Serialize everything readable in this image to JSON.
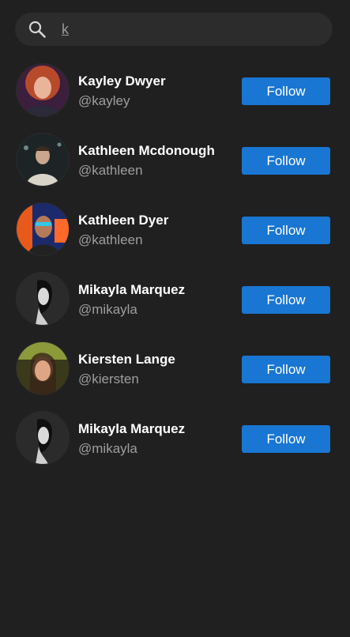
{
  "search": {
    "value": "k",
    "icon": "search-icon"
  },
  "users": [
    {
      "name": "Kayley Dwyer",
      "handle": "@kayley",
      "follow_label": "Follow"
    },
    {
      "name": "Kathleen Mcdonough",
      "handle": "@kathleen",
      "follow_label": "Follow"
    },
    {
      "name": "Kathleen Dyer",
      "handle": "@kathleen",
      "follow_label": "Follow"
    },
    {
      "name": "Mikayla Marquez",
      "handle": "@mikayla",
      "follow_label": "Follow"
    },
    {
      "name": "Kiersten Lange",
      "handle": "@kiersten",
      "follow_label": "Follow"
    },
    {
      "name": "Mikayla Marquez",
      "handle": "@mikayla",
      "follow_label": "Follow"
    }
  ],
  "colors": {
    "background": "#202020",
    "search_bar": "#2c2c2c",
    "accent": "#1976d2",
    "secondary_text": "#9e9e9e"
  }
}
